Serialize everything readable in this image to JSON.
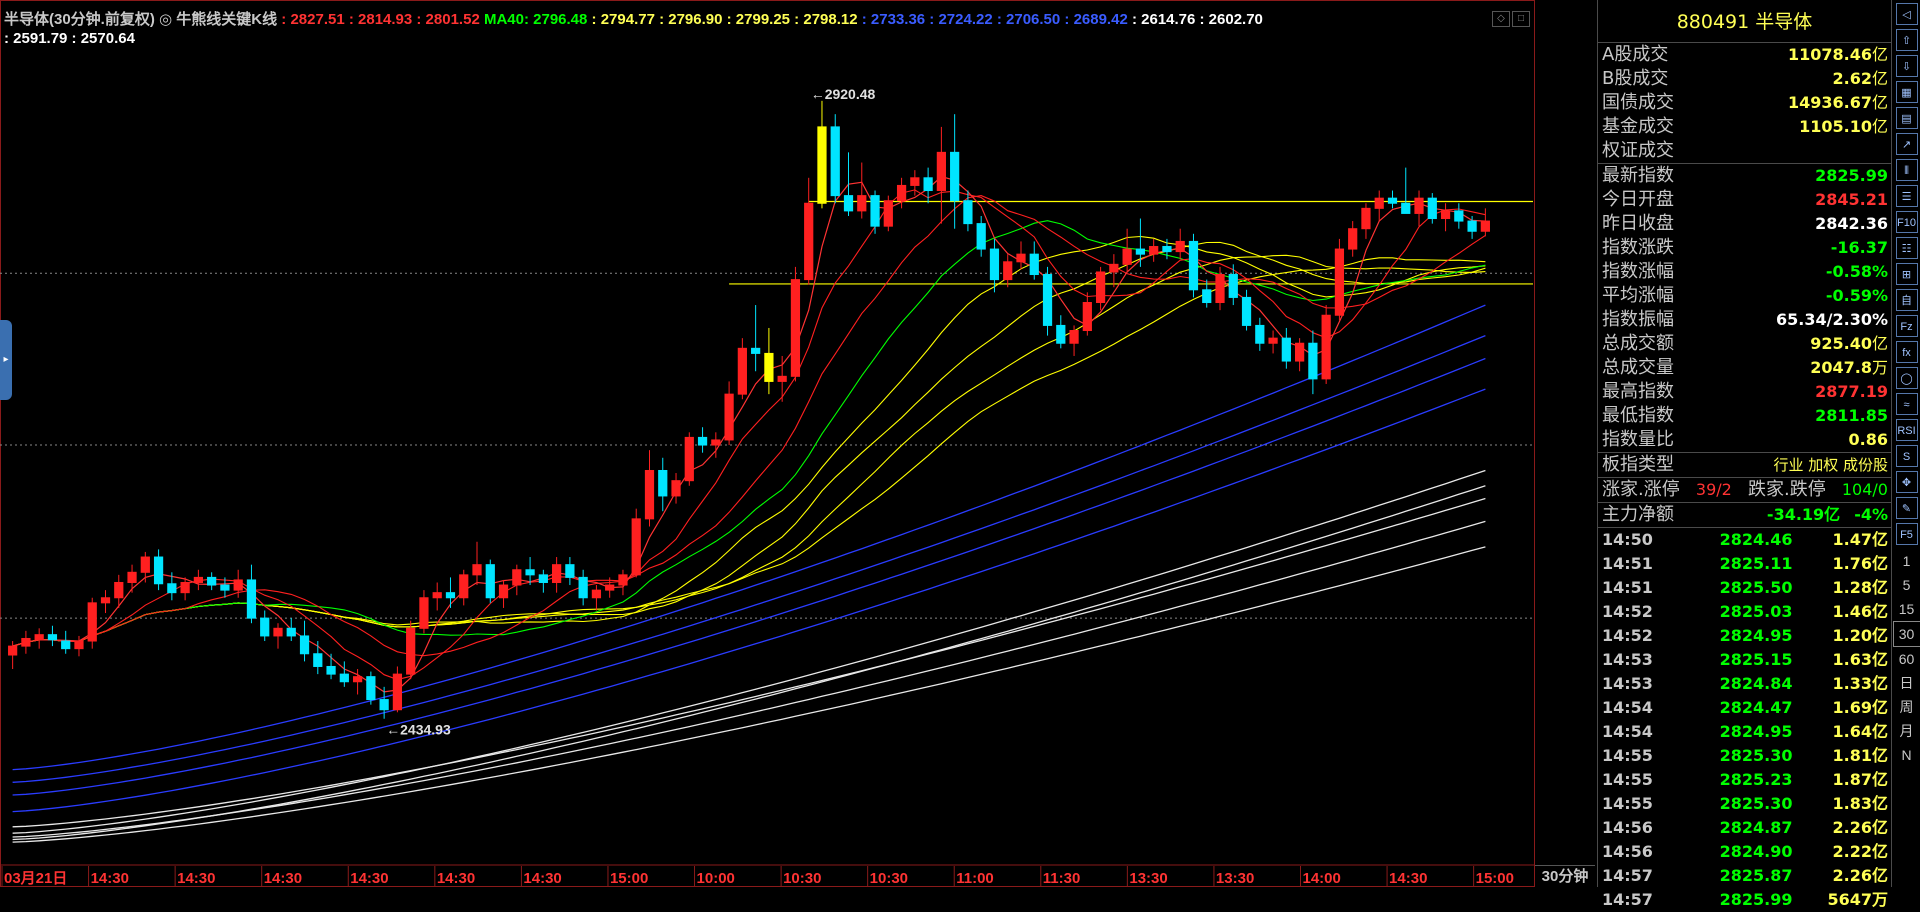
{
  "header": {
    "line1": [
      {
        "text": "半导体(30分钟.前复权)",
        "color": "#c8c8c8"
      },
      {
        "text": " ◎ ",
        "color": "#c8c8c8"
      },
      {
        "text": "牛熊线关键K线 ",
        "color": "#c8c8c8"
      },
      {
        "text": ": 2827.51 : 2814.93 : 2801.52 ",
        "color": "#ff3333"
      },
      {
        "text": "MA40: 2796.48 ",
        "color": "#00ff00"
      },
      {
        "text": ": 2794.77 : 2796.90 : 2799.25 : 2798.12 ",
        "color": "#ffff55"
      },
      {
        "text": ": 2733.36 : 2724.22 : 2706.50 : 2689.42 ",
        "color": "#3a5cff"
      },
      {
        "text": ": 2614.76 : 2602.70",
        "color": "#ffffff"
      }
    ],
    "line2": ": 2591.79 : 2570.64",
    "icons": [
      "◇",
      "□"
    ]
  },
  "chart_data": {
    "type": "candlestick",
    "price_axis": {
      "min": 2320,
      "max": 2984,
      "ticks": [
        2785,
        2650,
        2514
      ]
    },
    "time_labels": [
      "03月21日",
      "14:30",
      "14:30",
      "14:30",
      "14:30",
      "14:30",
      "14:30",
      "15:00",
      "10:00",
      "10:30",
      "10:30",
      "11:00",
      "11:30",
      "13:30",
      "13:30",
      "14:00",
      "14:30",
      "15:00"
    ],
    "annotations": [
      {
        "text": "2920.48",
        "price": 2920.48,
        "bar": 60
      },
      {
        "text": "2434.93",
        "price": 2434.93,
        "bar": 28
      }
    ],
    "hlines": [
      2841.4,
      2776.6
    ],
    "bars": [
      [
        2485,
        2496,
        2474,
        2492
      ],
      [
        2492,
        2504,
        2486,
        2498
      ],
      [
        2497,
        2506,
        2490,
        2501
      ],
      [
        2501,
        2508,
        2492,
        2497
      ],
      [
        2496,
        2504,
        2486,
        2490
      ],
      [
        2490,
        2500,
        2484,
        2496
      ],
      [
        2496,
        2530,
        2490,
        2526
      ],
      [
        2526,
        2536,
        2518,
        2530
      ],
      [
        2530,
        2548,
        2522,
        2542
      ],
      [
        2542,
        2556,
        2534,
        2550
      ],
      [
        2550,
        2566,
        2542,
        2562
      ],
      [
        2562,
        2568,
        2536,
        2541
      ],
      [
        2541,
        2550,
        2528,
        2534
      ],
      [
        2534,
        2546,
        2528,
        2542
      ],
      [
        2542,
        2552,
        2536,
        2546
      ],
      [
        2546,
        2550,
        2536,
        2540
      ],
      [
        2540,
        2546,
        2530,
        2536
      ],
      [
        2536,
        2552,
        2530,
        2544
      ],
      [
        2544,
        2556,
        2510,
        2514
      ],
      [
        2514,
        2520,
        2496,
        2500
      ],
      [
        2500,
        2510,
        2490,
        2506
      ],
      [
        2506,
        2514,
        2496,
        2500
      ],
      [
        2500,
        2512,
        2480,
        2486
      ],
      [
        2486,
        2496,
        2470,
        2476
      ],
      [
        2476,
        2486,
        2466,
        2470
      ],
      [
        2470,
        2480,
        2460,
        2464
      ],
      [
        2464,
        2474,
        2454,
        2468
      ],
      [
        2468,
        2472,
        2446,
        2450
      ],
      [
        2450,
        2460,
        2434.93,
        2442
      ],
      [
        2442,
        2476,
        2440,
        2470
      ],
      [
        2470,
        2512,
        2466,
        2506
      ],
      [
        2506,
        2536,
        2502,
        2530
      ],
      [
        2530,
        2542,
        2520,
        2534
      ],
      [
        2534,
        2546,
        2522,
        2530
      ],
      [
        2530,
        2552,
        2524,
        2548
      ],
      [
        2548,
        2574,
        2540,
        2556
      ],
      [
        2556,
        2560,
        2526,
        2530
      ],
      [
        2530,
        2544,
        2522,
        2540
      ],
      [
        2540,
        2556,
        2532,
        2552
      ],
      [
        2552,
        2562,
        2540,
        2548
      ],
      [
        2548,
        2552,
        2534,
        2542
      ],
      [
        2542,
        2562,
        2534,
        2556
      ],
      [
        2556,
        2562,
        2540,
        2546
      ],
      [
        2546,
        2552,
        2524,
        2530
      ],
      [
        2530,
        2540,
        2520,
        2536
      ],
      [
        2536,
        2546,
        2530,
        2540
      ],
      [
        2540,
        2552,
        2532,
        2548
      ],
      [
        2548,
        2600,
        2546,
        2592
      ],
      [
        2592,
        2646,
        2586,
        2630
      ],
      [
        2630,
        2640,
        2598,
        2610
      ],
      [
        2610,
        2628,
        2604,
        2622
      ],
      [
        2622,
        2660,
        2618,
        2656
      ],
      [
        2656,
        2664,
        2644,
        2650
      ],
      [
        2650,
        2660,
        2640,
        2654
      ],
      [
        2654,
        2700,
        2650,
        2690
      ],
      [
        2690,
        2734,
        2686,
        2726
      ],
      [
        2726,
        2760,
        2708,
        2722
      ],
      [
        2722,
        2742,
        2690,
        2700
      ],
      [
        2700,
        2720,
        2684,
        2704
      ],
      [
        2704,
        2790,
        2700,
        2780
      ],
      [
        2780,
        2860,
        2776,
        2840
      ],
      [
        2840,
        2920.48,
        2836,
        2900
      ],
      [
        2900,
        2910,
        2840,
        2846
      ],
      [
        2846,
        2880,
        2830,
        2834
      ],
      [
        2834,
        2872,
        2828,
        2846
      ],
      [
        2846,
        2850,
        2816,
        2822
      ],
      [
        2822,
        2846,
        2818,
        2842
      ],
      [
        2842,
        2860,
        2836,
        2854
      ],
      [
        2854,
        2866,
        2846,
        2860
      ],
      [
        2860,
        2868,
        2840,
        2850
      ],
      [
        2850,
        2900,
        2824,
        2880
      ],
      [
        2880,
        2910,
        2820,
        2842
      ],
      [
        2842,
        2850,
        2818,
        2824
      ],
      [
        2824,
        2830,
        2798,
        2804
      ],
      [
        2804,
        2812,
        2770,
        2780
      ],
      [
        2780,
        2800,
        2774,
        2794
      ],
      [
        2794,
        2810,
        2788,
        2800
      ],
      [
        2800,
        2810,
        2780,
        2784
      ],
      [
        2784,
        2790,
        2736,
        2744
      ],
      [
        2744,
        2752,
        2726,
        2730
      ],
      [
        2730,
        2744,
        2720,
        2740
      ],
      [
        2740,
        2770,
        2736,
        2762
      ],
      [
        2762,
        2790,
        2756,
        2786
      ],
      [
        2786,
        2800,
        2774,
        2792
      ],
      [
        2792,
        2820,
        2786,
        2804
      ],
      [
        2804,
        2828,
        2790,
        2800
      ],
      [
        2800,
        2812,
        2794,
        2806
      ],
      [
        2806,
        2812,
        2796,
        2802
      ],
      [
        2802,
        2820,
        2796,
        2810
      ],
      [
        2810,
        2816,
        2766,
        2772
      ],
      [
        2772,
        2780,
        2758,
        2762
      ],
      [
        2762,
        2790,
        2756,
        2784
      ],
      [
        2784,
        2792,
        2760,
        2766
      ],
      [
        2766,
        2772,
        2740,
        2744
      ],
      [
        2744,
        2750,
        2724,
        2730
      ],
      [
        2730,
        2740,
        2722,
        2734
      ],
      [
        2734,
        2742,
        2710,
        2716
      ],
      [
        2716,
        2734,
        2708,
        2730
      ],
      [
        2730,
        2740,
        2690,
        2702
      ],
      [
        2702,
        2760,
        2698,
        2752
      ],
      [
        2752,
        2812,
        2748,
        2804
      ],
      [
        2804,
        2826,
        2798,
        2820
      ],
      [
        2820,
        2840,
        2812,
        2836
      ],
      [
        2836,
        2850,
        2826,
        2844
      ],
      [
        2844,
        2850,
        2836,
        2840
      ],
      [
        2840,
        2868,
        2836,
        2832
      ],
      [
        2832,
        2850,
        2822,
        2844
      ],
      [
        2844,
        2848,
        2824,
        2828
      ],
      [
        2828,
        2840,
        2818,
        2834
      ],
      [
        2834,
        2840,
        2820,
        2826
      ],
      [
        2826,
        2830,
        2812,
        2818
      ],
      [
        2818,
        2836,
        2814,
        2826
      ]
    ],
    "colors": {
      "up": "#ff2020",
      "down": "#00e5ff",
      "highlight": "#ffff00"
    }
  },
  "panel": {
    "title": "880491 半导体",
    "volume_rows": [
      {
        "label": "A股成交",
        "value": "11078.46",
        "unit": "亿",
        "color": "#ffff55"
      },
      {
        "label": "B股成交",
        "value": "2.62",
        "unit": "亿",
        "color": "#ffff55"
      },
      {
        "label": "国债成交",
        "value": "14936.67",
        "unit": "亿",
        "color": "#ffff55"
      },
      {
        "label": "基金成交",
        "value": "1105.10",
        "unit": "亿",
        "color": "#ffff55"
      },
      {
        "label": "权证成交",
        "value": "",
        "unit": "",
        "color": "#ffff55"
      }
    ],
    "index_rows": [
      {
        "label": "最新指数",
        "value": "2825.99",
        "color": "#00ff00"
      },
      {
        "label": "今日开盘",
        "value": "2845.21",
        "color": "#ff3333"
      },
      {
        "label": "昨日收盘",
        "value": "2842.36",
        "color": "#ffffff"
      },
      {
        "label": "指数涨跌",
        "value": "-16.37",
        "color": "#00ff00"
      },
      {
        "label": "指数涨幅",
        "value": "-0.58%",
        "color": "#00ff00"
      },
      {
        "label": "平均涨幅",
        "value": "-0.59%",
        "color": "#00ff00"
      },
      {
        "label": "指数振幅",
        "value": "65.34/2.30%",
        "color": "#ffffff"
      },
      {
        "label": "总成交额",
        "value": "925.40",
        "unit": "亿",
        "color": "#ffff55"
      },
      {
        "label": "总成交量",
        "value": "2047.8",
        "unit": "万",
        "color": "#ffff55"
      },
      {
        "label": "最高指数",
        "value": "2877.19",
        "color": "#ff3333"
      },
      {
        "label": "最低指数",
        "value": "2811.85",
        "color": "#00ff00"
      },
      {
        "label": "指数量比",
        "value": "0.86",
        "color": "#ffff55"
      }
    ],
    "type_row": {
      "label": "板指类型",
      "value": "行业 加权 成份股"
    },
    "updown_row": {
      "label1": "涨家.涨停",
      "val1": "39/2",
      "label2": "跌家.跌停",
      "val2": "104/0"
    },
    "flow_row": {
      "label": "主力净额",
      "value": "-34.19亿",
      "pct": "-4%"
    },
    "ticks": [
      {
        "t": "14:50",
        "p": "2824.46",
        "v": "1.47亿"
      },
      {
        "t": "14:51",
        "p": "2825.11",
        "v": "1.76亿"
      },
      {
        "t": "14:51",
        "p": "2825.50",
        "v": "1.28亿"
      },
      {
        "t": "14:52",
        "p": "2825.03",
        "v": "1.46亿"
      },
      {
        "t": "14:52",
        "p": "2824.95",
        "v": "1.20亿"
      },
      {
        "t": "14:53",
        "p": "2825.15",
        "v": "1.63亿"
      },
      {
        "t": "14:53",
        "p": "2824.84",
        "v": "1.33亿"
      },
      {
        "t": "14:54",
        "p": "2824.47",
        "v": "1.69亿"
      },
      {
        "t": "14:54",
        "p": "2824.95",
        "v": "1.64亿"
      },
      {
        "t": "14:55",
        "p": "2825.30",
        "v": "1.81亿"
      },
      {
        "t": "14:55",
        "p": "2825.23",
        "v": "1.87亿"
      },
      {
        "t": "14:55",
        "p": "2825.30",
        "v": "1.83亿"
      },
      {
        "t": "14:56",
        "p": "2824.87",
        "v": "2.26亿"
      },
      {
        "t": "14:56",
        "p": "2824.90",
        "v": "2.22亿"
      },
      {
        "t": "14:57",
        "p": "2825.87",
        "v": "2.26亿"
      },
      {
        "t": "14:57",
        "p": "2825.99",
        "v": "5647万"
      }
    ]
  },
  "period_tab": "30分钟",
  "tools": {
    "icons": [
      "nav-left-icon",
      "nav-up-icon",
      "nav-down-icon",
      "grid-icon",
      "table-icon",
      "line-chart-icon",
      "candle-icon",
      "list-icon",
      "f10-icon",
      "info-icon",
      "stats-icon",
      "fund-icon",
      "formula-icon",
      "circle-icon",
      "wave-icon",
      "rsi-icon",
      "s-icon",
      "move-icon",
      "pen-icon",
      "f5-icon",
      "refresh-icon"
    ],
    "icon_text": [
      "◁",
      "⇧",
      "⇩",
      "▦",
      "▤",
      "↗",
      "⫴",
      "☰",
      "F10",
      "☷",
      "⊞",
      "自",
      "Fz",
      "fx",
      "◯",
      "≈",
      "RSI",
      "S",
      "✥",
      "✎",
      "F5",
      "⟳"
    ],
    "periods": [
      "1",
      "5",
      "15",
      "30",
      "60",
      "日",
      "周",
      "月",
      "N"
    ],
    "selected_period": "30"
  }
}
